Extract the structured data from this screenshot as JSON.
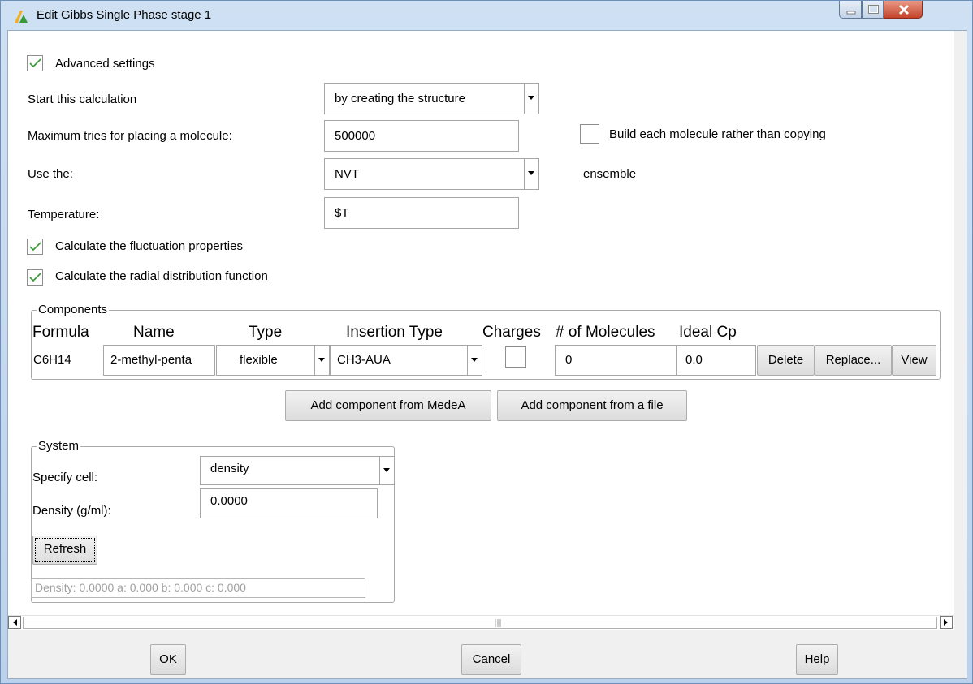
{
  "window": {
    "title": "Edit Gibbs Single Phase stage 1",
    "controls": [
      "minimize-icon",
      "maximize-icon",
      "close-icon"
    ]
  },
  "advanced": {
    "label": "Advanced settings",
    "checked": true
  },
  "start": {
    "label": "Start this calculation",
    "value": "by creating the structure"
  },
  "max_tries": {
    "label": "Maximum tries for placing a molecule:",
    "value": "500000"
  },
  "build": {
    "label": "Build each molecule rather than copying",
    "checked": false
  },
  "use": {
    "label": "Use the:",
    "value": "NVT",
    "suffix": "ensemble"
  },
  "temperature": {
    "label": "Temperature:",
    "value": "$T"
  },
  "fluct": {
    "label": "Calculate the fluctuation properties",
    "checked": true
  },
  "rdf": {
    "label": "Calculate the radial distribution function",
    "checked": true
  },
  "components": {
    "title": "Components",
    "headers": {
      "formula": "Formula",
      "name": "Name",
      "type": "Type",
      "insertion": "Insertion Type",
      "charges": "Charges",
      "molecules": "# of Molecules",
      "cp": "Ideal Cp"
    },
    "rows": [
      {
        "formula": "C6H14",
        "name": "2-methyl-penta",
        "type": "flexible",
        "insertion": "CH3-AUA",
        "charges": false,
        "molecules": "0",
        "cp": "0.0",
        "delete": "Delete",
        "replace": "Replace...",
        "view": "View"
      }
    ],
    "add_medea": "Add component from MedeA",
    "add_file": "Add component from a file"
  },
  "system": {
    "title": "System",
    "cell_label": "Specify cell:",
    "cell_value": "density",
    "density_label": "Density (g/ml):",
    "density_value": "0.0000",
    "refresh": "Refresh",
    "summary": "Density: 0.0000   a:  0.000   b:  0.000   c:  0.000"
  },
  "footer": {
    "ok": "OK",
    "cancel": "Cancel",
    "help": "Help"
  },
  "colors": {
    "check": "#3c9a3c",
    "titlebar": "#bcd2ec",
    "close": "#c3432a"
  }
}
